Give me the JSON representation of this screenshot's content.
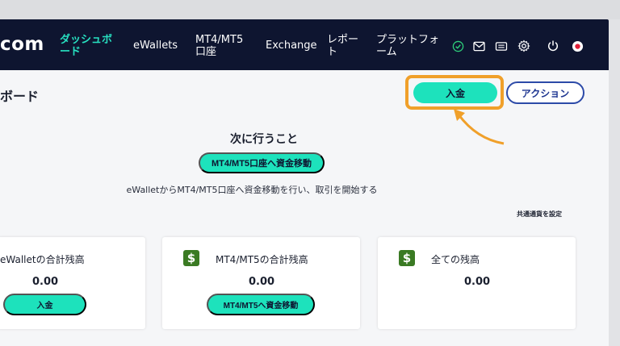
{
  "brand": {
    "text": "com"
  },
  "nav": {
    "dashboard": "ダッシュボード",
    "dashboard_line1": "ダッシュボ",
    "dashboard_line2": "ード",
    "ewallets": "eWallets",
    "accounts_line1": "MT4/MT5",
    "accounts_line2": "口座",
    "exchange": "Exchange",
    "report_line1": "レポー",
    "report_line2": "ト",
    "platform_line1": "プラットフォ",
    "platform_line2": "ーム"
  },
  "page": {
    "title": "ボード",
    "deposit_label": "入金",
    "action_label": "アクション"
  },
  "next": {
    "title": "次に行うこと",
    "transfer_label": "MT4/MT5口座へ資金移動",
    "description": "eWalletからMT4/MT5口座へ資金移動を行い、取引を開始する",
    "base_currency_label": "共通通貨を設定"
  },
  "cards": [
    {
      "title": "eWalletの合計残高",
      "amount": "0.00",
      "button": "入金"
    },
    {
      "title": "MT4/MT5の合計残高",
      "amount": "0.00",
      "button": "MT4/MT5へ資金移動"
    },
    {
      "title": "全ての残高",
      "amount": "0.00"
    }
  ],
  "colors": {
    "navbar": "#0e1530",
    "accent": "#1de2bc",
    "highlight": "#f0a02a",
    "dollar_badge": "#3a7a23"
  },
  "icons": [
    "check-circle-icon",
    "mail-icon",
    "ticket-icon",
    "gear-icon",
    "power-icon",
    "japan-flag-icon"
  ]
}
